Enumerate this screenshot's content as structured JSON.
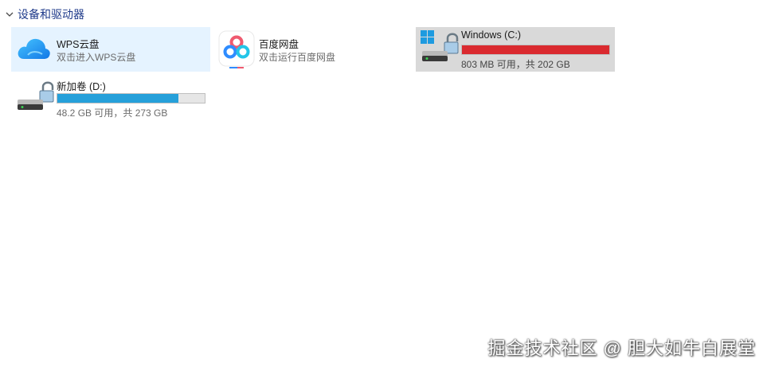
{
  "group": {
    "title": "设备和驱动器"
  },
  "items": [
    {
      "name": "WPS云盘",
      "subtitle": "双击进入WPS云盘",
      "icon": "wps-cloud-icon"
    },
    {
      "name": "百度网盘",
      "subtitle": "双击运行百度网盘",
      "icon": "baidu-netdisk-icon"
    },
    {
      "name": "Windows  (C:)",
      "space_text": "803 MB 可用，共 202 GB",
      "icon": "windows-drive-icon",
      "used_fraction": 1.0,
      "bar_color": "#da2a2f"
    },
    {
      "name": "新加卷 (D:)",
      "space_text": "48.2 GB 可用，共 273 GB",
      "icon": "drive-icon",
      "used_fraction": 0.82,
      "bar_color": "#26a0da"
    }
  ],
  "watermark": "掘金技术社区 @ 胆大如牛白展堂",
  "colors": {
    "selected_bg": "#e5f3ff",
    "hover_bg": "#d9d9d9"
  }
}
